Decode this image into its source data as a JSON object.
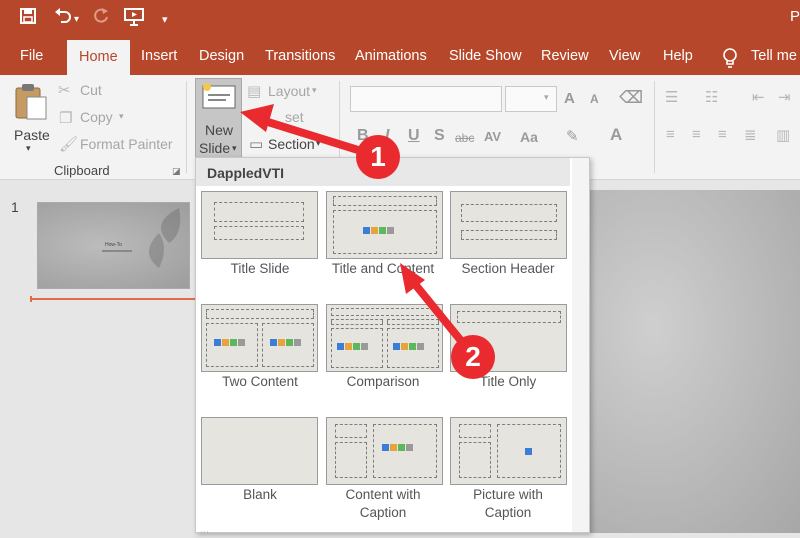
{
  "quick_access": {
    "save_icon": "save-icon",
    "undo_icon": "undo-icon",
    "redo_icon": "redo-icon",
    "present_icon": "present-from-start-icon",
    "customize_icon": "customize-qat-icon",
    "title_fragment": "P"
  },
  "tabs": [
    {
      "label": "File"
    },
    {
      "label": "Home"
    },
    {
      "label": "Insert"
    },
    {
      "label": "Design"
    },
    {
      "label": "Transitions"
    },
    {
      "label": "Animations"
    },
    {
      "label": "Slide Show"
    },
    {
      "label": "Review"
    },
    {
      "label": "View"
    },
    {
      "label": "Help"
    }
  ],
  "tell_me": "Tell me",
  "ribbon": {
    "clipboard": {
      "paste": "Paste",
      "cut": "Cut",
      "copy": "Copy",
      "format_painter": "Format Painter",
      "group_label": "Clipboard"
    },
    "slides": {
      "new_slide_line1": "New",
      "new_slide_line2": "Slide",
      "layout": "Layout",
      "reset_fragment": "set",
      "section": "Section"
    }
  },
  "thumbnails": [
    {
      "number": "1",
      "title": "How-To"
    }
  ],
  "gallery": {
    "theme_name": "DappledVTI",
    "layouts": [
      {
        "label": "Title Slide"
      },
      {
        "label": "Title and Content"
      },
      {
        "label": "Section Header"
      },
      {
        "label": "Two Content"
      },
      {
        "label": "Comparison"
      },
      {
        "label": "Title Only"
      },
      {
        "label": "Blank"
      },
      {
        "label_line1": "Content with",
        "label_line2": "Caption"
      },
      {
        "label_line1": "Picture with",
        "label_line2": "Caption"
      }
    ]
  },
  "annotations": {
    "step1": "1",
    "step2": "2",
    "color": "#e92a2e"
  },
  "colors": {
    "accent": "#b7472a",
    "ribbon_bg": "#f3f3f3"
  }
}
